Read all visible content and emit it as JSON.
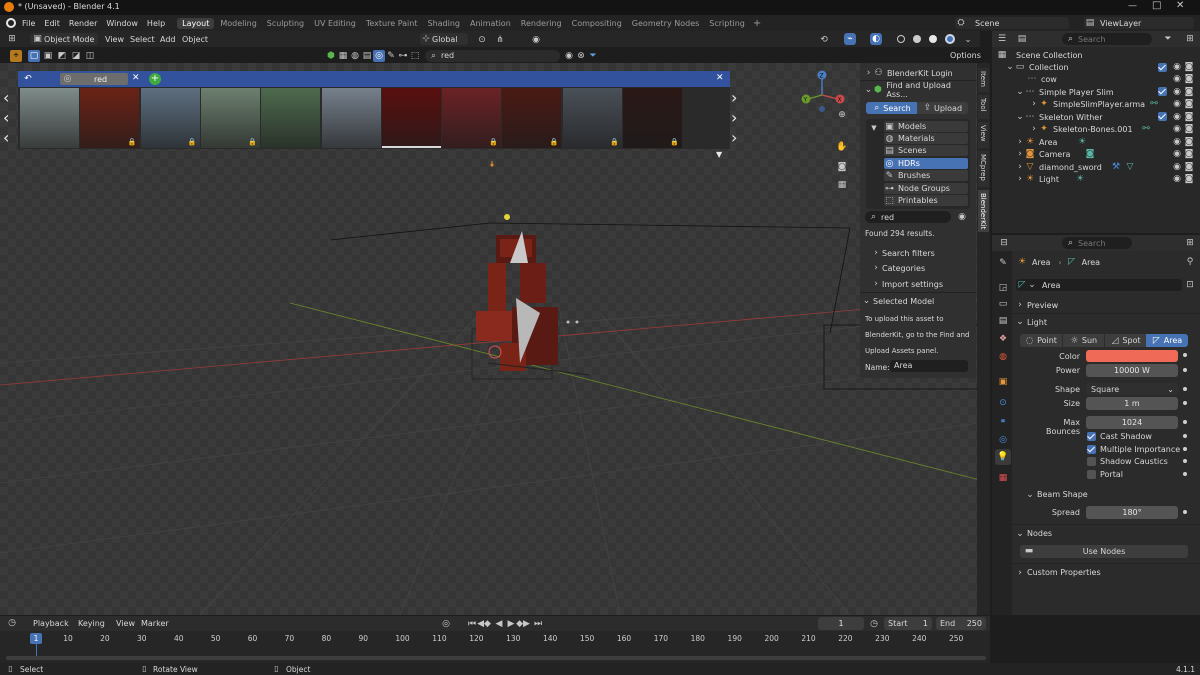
{
  "window": {
    "title": "* (Unsaved) - Blender 4.1"
  },
  "menu": {
    "items": [
      "File",
      "Edit",
      "Render",
      "Window",
      "Help"
    ]
  },
  "workspaces": [
    "Layout",
    "Modeling",
    "Sculpting",
    "UV Editing",
    "Texture Paint",
    "Shading",
    "Animation",
    "Rendering",
    "Compositing",
    "Geometry Nodes",
    "Scripting"
  ],
  "scene": {
    "name": "Scene",
    "view_layer": "ViewLayer"
  },
  "viewport_header": {
    "mode": "Object Mode",
    "menus": [
      "View",
      "Select",
      "Add",
      "Object"
    ],
    "orientation": "Global",
    "search_value": "red",
    "options_label": "Options"
  },
  "asset_bar": {
    "tab_label": "red",
    "thumb_colors": [
      "#7f8c8a",
      "#6b2216",
      "#5e6f80",
      "#6d8070",
      "#4e6a4e",
      "#76808c",
      "#5a0f0f",
      "#6b2225",
      "#4a1a14",
      "#4a5058",
      "#2a1816"
    ]
  },
  "bk_panel": {
    "login": "BlenderKit Login",
    "find_upload": "Find and Upload Ass...",
    "search_tab": "Search",
    "upload_tab": "Upload",
    "categories": [
      "Models",
      "Materials",
      "Scenes",
      "HDRs",
      "Brushes",
      "Node Groups",
      "Printables"
    ],
    "search_value": "red",
    "results": "Found 294 results.",
    "sections": [
      "Search filters",
      "Categories",
      "Import settings"
    ],
    "selected_model": "Selected Model",
    "upload_note": [
      "To upload this asset to",
      "BlenderKit, go to the Find and",
      "Upload Assets panel."
    ],
    "name_label": "Name:",
    "name_value": "Area"
  },
  "side_tabs": [
    "Item",
    "Tool",
    "View",
    "MCprep",
    "BlenderKit"
  ],
  "outliner": {
    "search_placeholder": "Search",
    "items": [
      {
        "label": "Scene Collection",
        "indent": 0
      },
      {
        "label": "Collection",
        "indent": 1
      },
      {
        "label": "cow",
        "indent": 2
      },
      {
        "label": "Simple Player Slim",
        "indent": 2
      },
      {
        "label": "SimpleSlimPlayer.arma",
        "indent": 3
      },
      {
        "label": "Skeleton Wither",
        "indent": 2
      },
      {
        "label": "Skeleton-Bones.001",
        "indent": 3
      },
      {
        "label": "Area",
        "indent": 2
      },
      {
        "label": "Camera",
        "indent": 2
      },
      {
        "label": "diamond_sword",
        "indent": 2
      },
      {
        "label": "Light",
        "indent": 2
      }
    ]
  },
  "properties": {
    "search_placeholder": "Search",
    "crumb_obj": "Area",
    "crumb_data": "Area",
    "datablock": "Area",
    "preview": "Preview",
    "light_section": "Light",
    "types": [
      "Point",
      "Sun",
      "Spot",
      "Area"
    ],
    "color_label": "Color",
    "color_value": "#ef6a57",
    "power_label": "Power",
    "power_value": "10000 W",
    "shape_label": "Shape",
    "shape_value": "Square",
    "size_label": "Size",
    "size_value": "1 m",
    "max_bounces_label": "Max Bounces",
    "max_bounces_value": "1024",
    "cast_shadow": "Cast Shadow",
    "multiple_importance": "Multiple Importance",
    "shadow_caustics": "Shadow Caustics",
    "portal": "Portal",
    "beam_shape": "Beam Shape",
    "spread_label": "Spread",
    "spread_value": "180°",
    "nodes": "Nodes",
    "use_nodes": "Use Nodes",
    "custom_properties": "Custom Properties"
  },
  "timeline": {
    "menus": [
      "Playback",
      "Keying",
      "View",
      "Marker"
    ],
    "current_frame": "1",
    "start_label": "Start",
    "start_value": "1",
    "end_label": "End",
    "end_value": "250",
    "ruler": [
      "10",
      "20",
      "30",
      "40",
      "50",
      "60",
      "70",
      "80",
      "90",
      "100",
      "110",
      "120",
      "130",
      "140",
      "150",
      "160",
      "170",
      "180",
      "190",
      "200",
      "210",
      "220",
      "230",
      "240",
      "250"
    ],
    "playhead": "1"
  },
  "status": {
    "select": "Select",
    "rotate": "Rotate View",
    "object": "Object",
    "version": "4.1.1"
  }
}
